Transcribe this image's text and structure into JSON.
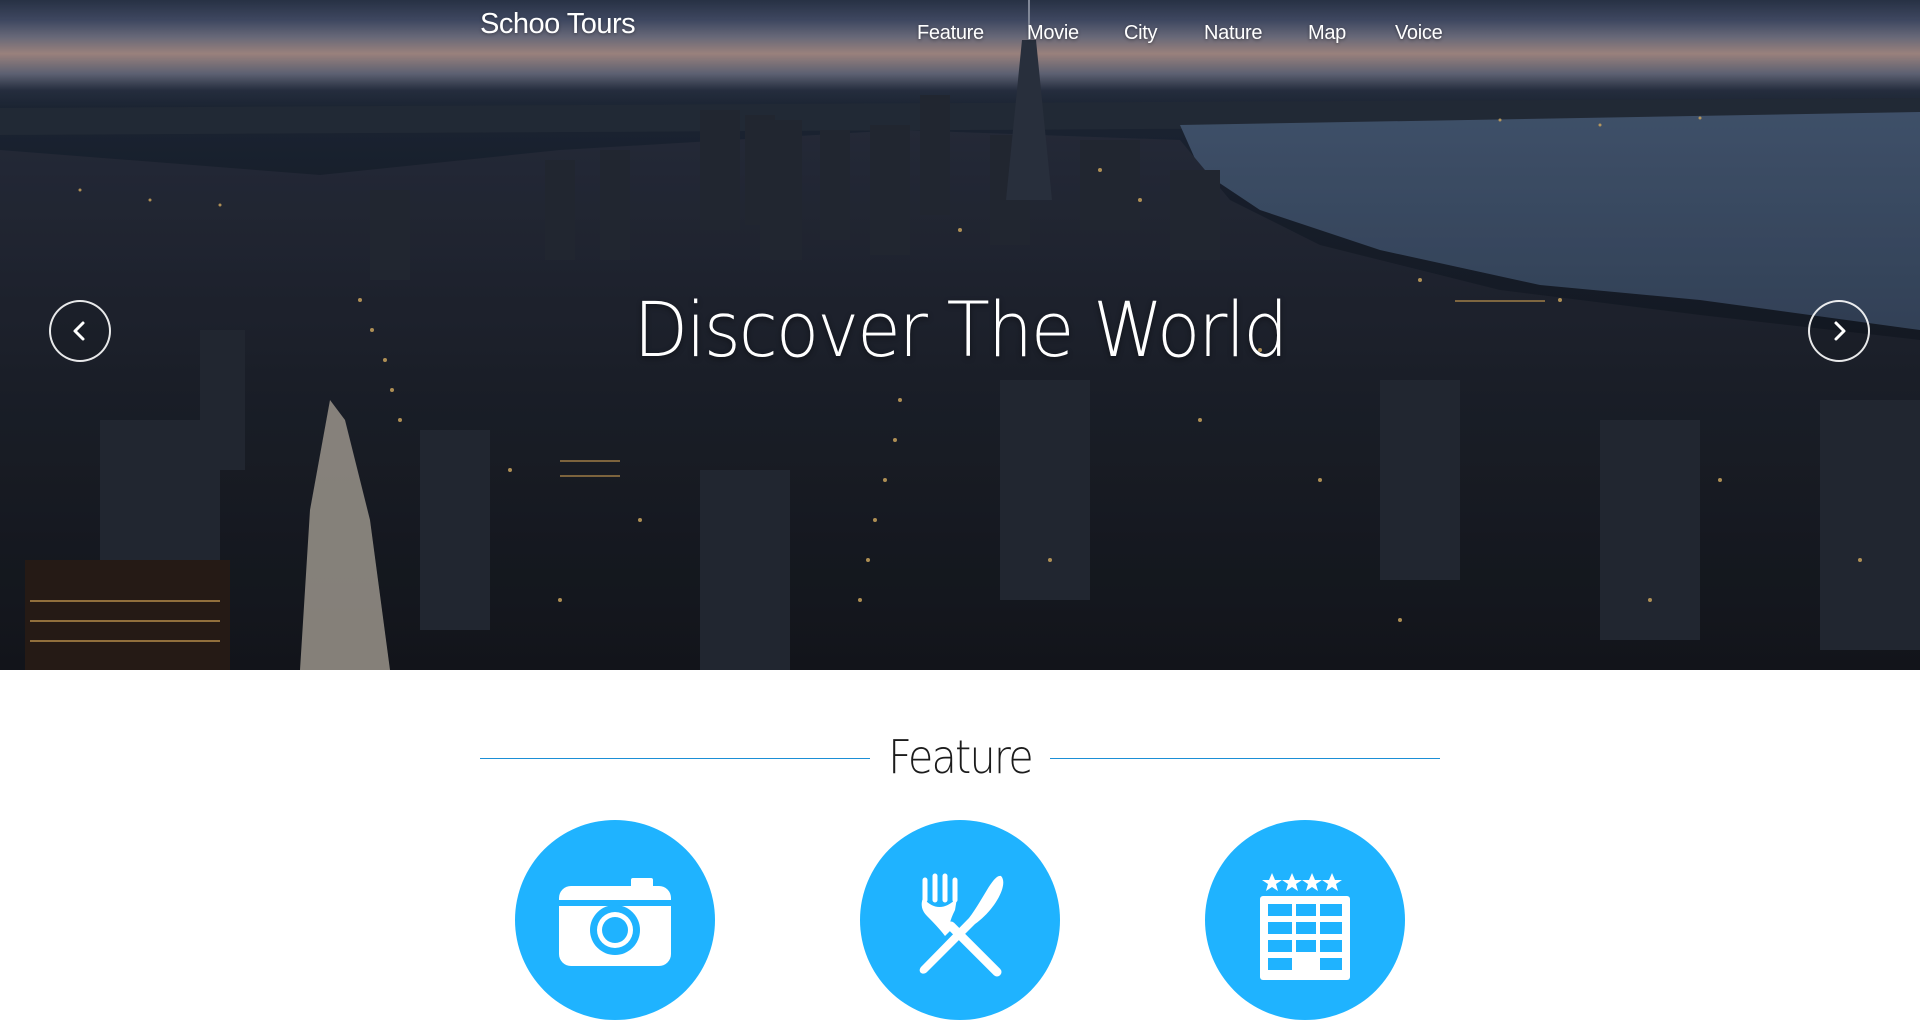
{
  "header": {
    "logo": "Schoo Tours",
    "nav": [
      {
        "label": "Feature"
      },
      {
        "label": "Movie"
      },
      {
        "label": "City"
      },
      {
        "label": "Nature"
      },
      {
        "label": "Map"
      },
      {
        "label": "Voice"
      }
    ]
  },
  "hero": {
    "title": "Discover The World",
    "prev_icon": "chevron-left-icon",
    "next_icon": "chevron-right-icon"
  },
  "feature": {
    "heading": "Feature",
    "items": [
      {
        "icon": "camera-icon"
      },
      {
        "icon": "fork-knife-icon"
      },
      {
        "icon": "hotel-icon"
      }
    ]
  },
  "colors": {
    "accent": "#1fb3ff",
    "rule": "#1b8fd6",
    "text_on_hero": "#ffffff"
  }
}
